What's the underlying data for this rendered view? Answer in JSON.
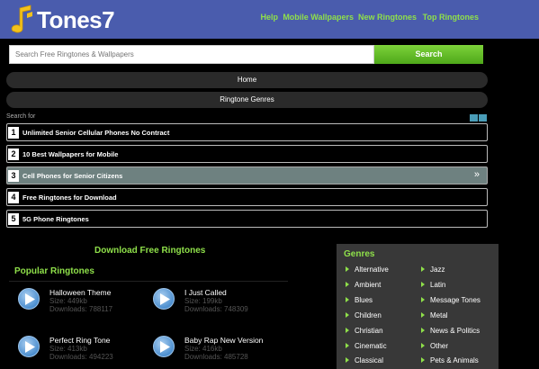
{
  "header": {
    "logo_text": "Tones7",
    "nav": [
      "Help",
      "Mobile Wallpapers",
      "New Ringtones",
      "Top Ringtones"
    ]
  },
  "search": {
    "placeholder": "Search Free Ringtones & Wallpapers",
    "button_label": "Search"
  },
  "menu": {
    "home": "Home",
    "genres": "Ringtone Genres"
  },
  "search_for": {
    "label": "Search for",
    "results": [
      {
        "num": "1",
        "label": "Unlimited Senior Cellular Phones No Contract"
      },
      {
        "num": "2",
        "label": "10 Best Wallpapers for Mobile"
      },
      {
        "num": "3",
        "label": "Cell Phones for Senior Citizens",
        "arrow": "»"
      },
      {
        "num": "4",
        "label": "Free Ringtones for Download"
      },
      {
        "num": "5",
        "label": "5G Phone Ringtones"
      }
    ]
  },
  "main": {
    "download_title": "Download Free Ringtones",
    "popular_title": "Popular Ringtones",
    "ringtones": [
      {
        "title": "Halloween Theme",
        "size": "Size: 449kb",
        "downloads": "Downloads: 788117"
      },
      {
        "title": "I Just Called",
        "size": "Size: 199kb",
        "downloads": "Downloads: 748309"
      },
      {
        "title": "Perfect Ring Tone",
        "size": "Size: 413kb",
        "downloads": "Downloads: 494223"
      },
      {
        "title": "Baby Rap New Version",
        "size": "Size: 416kb",
        "downloads": "Downloads: 485728"
      }
    ]
  },
  "genres": {
    "title": "Genres",
    "left": [
      "Alternative",
      "Ambient",
      "Blues",
      "Children",
      "Christian",
      "Cinematic",
      "Classical"
    ],
    "right": [
      "Jazz",
      "Latin",
      "Message Tones",
      "Metal",
      "News & Politics",
      "Other",
      "Pets & Animals"
    ]
  },
  "colors": {
    "header_bg": "#4a5cad",
    "accent_green": "#8fe04a",
    "page_bg": "#000000",
    "genres_bg": "#383838",
    "play_blue": "#4d8fcf"
  },
  "icons": [
    "music-note-logo-icon",
    "play-icon",
    "chevron-double-right-icon",
    "triangle-bullet-icon",
    "view-toggle-icon"
  ]
}
